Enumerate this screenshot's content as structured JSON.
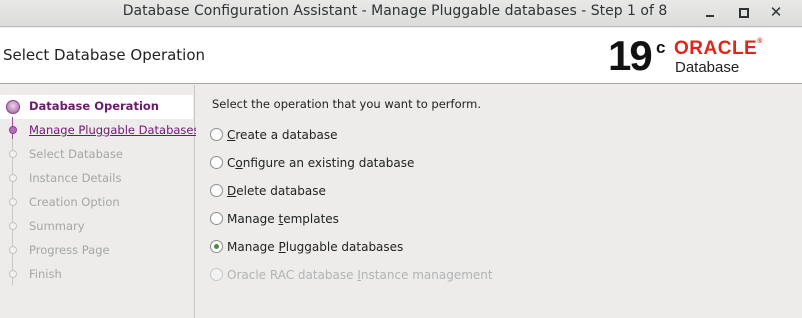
{
  "window": {
    "title": "Database Configuration Assistant - Manage Pluggable databases - Step 1 of 8",
    "controls": [
      "minimize-icon",
      "maximize-icon",
      "close-icon"
    ],
    "close_glyph": "✕"
  },
  "header": {
    "title": "Select Database Operation",
    "logo": {
      "version": "19",
      "version_sup": "c",
      "brand": "ORACLE",
      "brand_mark": "®",
      "product": "Database"
    }
  },
  "sidebar": {
    "steps": [
      {
        "label": "Database Operation",
        "state": "current"
      },
      {
        "label": "Manage Pluggable Databases",
        "state": "link"
      },
      {
        "label": "Select Database",
        "state": "disabled"
      },
      {
        "label": "Instance Details",
        "state": "disabled"
      },
      {
        "label": "Creation Option",
        "state": "disabled"
      },
      {
        "label": "Summary",
        "state": "disabled"
      },
      {
        "label": "Progress Page",
        "state": "disabled"
      },
      {
        "label": "Finish",
        "state": "disabled"
      }
    ]
  },
  "main": {
    "prompt": "Select the operation that you want to perform.",
    "options": [
      {
        "label": "Create a database",
        "mnemonic": "C",
        "rest": "reate a database",
        "selected": false,
        "enabled": true
      },
      {
        "label": "Configure an existing database",
        "mnemonic": "o",
        "pre": "C",
        "rest": "nfigure an existing database",
        "selected": false,
        "enabled": true
      },
      {
        "label": "Delete database",
        "mnemonic": "D",
        "rest": "elete database",
        "selected": false,
        "enabled": true
      },
      {
        "label": "Manage templates",
        "pre": "Manage ",
        "mnemonic": "t",
        "rest": "emplates",
        "selected": false,
        "enabled": true
      },
      {
        "label": "Manage Pluggable databases",
        "pre": "Manage ",
        "mnemonic": "P",
        "rest": "luggable databases",
        "selected": true,
        "enabled": true
      },
      {
        "label": "Oracle RAC database Instance management",
        "pre": "Oracle RAC database ",
        "mnemonic": "I",
        "rest": "nstance management",
        "selected": false,
        "enabled": false
      }
    ]
  },
  "colors": {
    "accent_purple": "#6a1b6b",
    "oracle_red": "#e0251b",
    "radio_selected": "#4a8f3c"
  }
}
